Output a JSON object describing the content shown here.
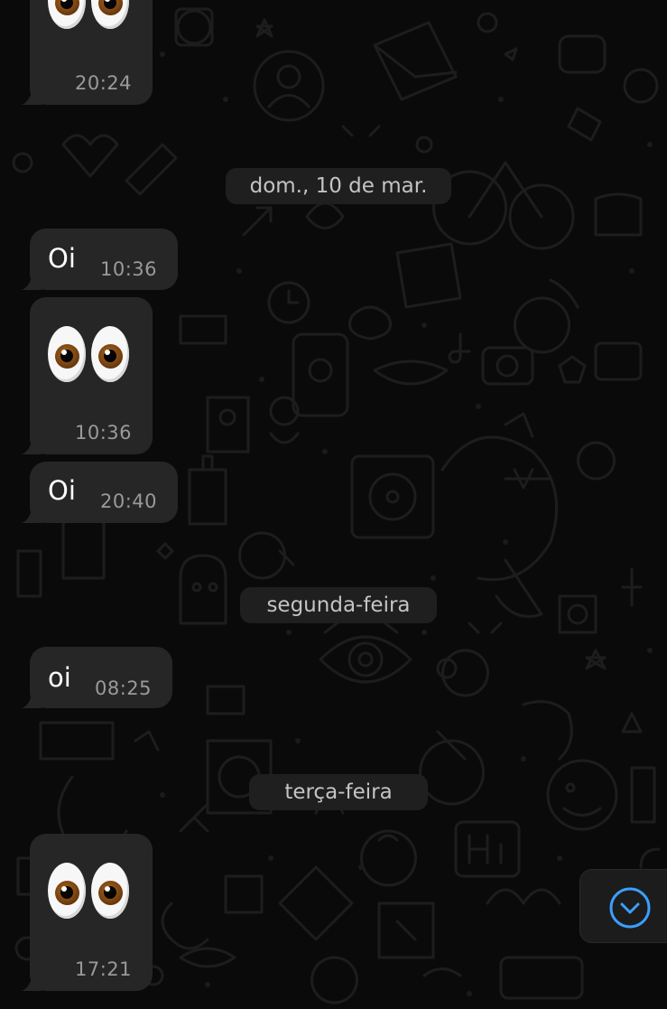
{
  "colors": {
    "background": "#0a0a0a",
    "bubble": "#262626",
    "bubble_text": "#ffffff",
    "timestamp": "#9a9a9a",
    "date_chip_bg": "#1f1f1f",
    "date_chip_text": "#c4c4c4",
    "accent": "#3b9eff"
  },
  "messages": [
    {
      "type": "emoji",
      "emoji": "👀",
      "time": "20:24"
    },
    {
      "type": "text",
      "text": "Oi",
      "time": "10:36"
    },
    {
      "type": "emoji",
      "emoji": "👀",
      "time": "10:36"
    },
    {
      "type": "text",
      "text": "Oi",
      "time": "20:40"
    },
    {
      "type": "text",
      "text": "oi",
      "time": "08:25"
    },
    {
      "type": "emoji",
      "emoji": "👀",
      "time": "17:21"
    }
  ],
  "date_separators": [
    {
      "label": "dom., 10 de mar."
    },
    {
      "label": "segunda-feira"
    },
    {
      "label": "terça-feira"
    }
  ],
  "scroll_button": {
    "icon": "chevron-down-circle-icon"
  }
}
